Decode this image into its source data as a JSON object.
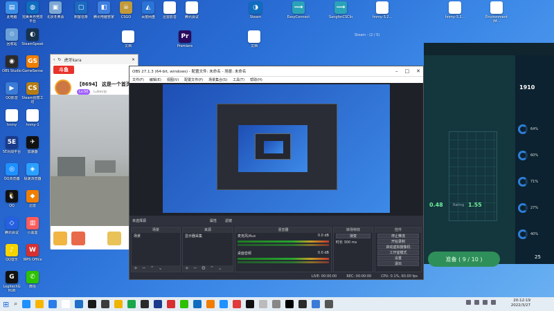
{
  "desktop_icons_col1": [
    {
      "label": "此电脑",
      "color": "#3a8ee6",
      "glyph": "▤"
    },
    {
      "label": "回收站",
      "color": "#6aa0d8",
      "glyph": "♲"
    },
    {
      "label": "OBS Studio",
      "color": "#2b2b2b",
      "glyph": "◉"
    },
    {
      "label": "QQ影音",
      "color": "#3a7bd5",
      "glyph": "▶"
    },
    {
      "label": "hnmy",
      "color": "#ffffff",
      "glyph": ""
    },
    {
      "label": "5E对战平台",
      "color": "#1a3a8a",
      "glyph": "5E"
    },
    {
      "label": "QQ浏览器",
      "color": "#1e90ff",
      "glyph": "◎"
    },
    {
      "label": "QQ",
      "color": "#111111",
      "glyph": "🐧"
    },
    {
      "label": "腾讯会议",
      "color": "#2460e0",
      "glyph": "◇"
    },
    {
      "label": "QQ音乐",
      "color": "#f6d400",
      "glyph": "♪"
    },
    {
      "label": "LogitechG HUB",
      "color": "#111111",
      "glyph": "G"
    }
  ],
  "desktop_icons_col2": [
    {
      "label": "完美世界竞技平台",
      "color": "#0f6dbf",
      "glyph": "◍"
    },
    {
      "label": "SteamSpeak",
      "color": "#16324f",
      "glyph": "◐"
    },
    {
      "label": "GameSense",
      "color": "#f07e00",
      "glyph": "GS"
    },
    {
      "label": "Steam创意工坊",
      "color": "#b57c14",
      "glyph": "CS"
    },
    {
      "label": "hnmy-1",
      "color": "#ffffff",
      "glyph": ""
    },
    {
      "label": "加速器",
      "color": "#111111",
      "glyph": "✈"
    },
    {
      "label": "极速浏览器",
      "color": "#2ba0ff",
      "glyph": "◈"
    },
    {
      "label": "迅雷",
      "color": "#f07e00",
      "glyph": "◆"
    },
    {
      "label": "小黑盒",
      "color": "#ff5c5c",
      "glyph": "▥"
    },
    {
      "label": "WPS Office",
      "color": "#d63031",
      "glyph": "W"
    },
    {
      "label": "微信",
      "color": "#2dc100",
      "glyph": "✆"
    }
  ],
  "desktop_icons_top": [
    {
      "label": "北京冬奥会",
      "color": "#7da8d4",
      "glyph": "▣"
    },
    {
      "label": "刺客信条",
      "color": "#1a6abf",
      "glyph": "▢"
    },
    {
      "label": "腾讯电脑管家",
      "color": "#3f7fe0",
      "glyph": "◧"
    },
    {
      "label": "CSGO",
      "color": "#c29a3b",
      "glyph": "☠"
    },
    {
      "label": "百度网盘",
      "color": "#2a74d6",
      "glyph": "◭"
    },
    {
      "label": "迅雷影音",
      "color": "#ffffff",
      "glyph": ""
    },
    {
      "label": "腾讯会议",
      "color": "#ffffff",
      "glyph": ""
    },
    {
      "label": "Steam",
      "color": "#0f6dbf",
      "glyph": "◑"
    },
    {
      "label": "EasyConnect",
      "color": "#2aa3b8",
      "glyph": "⟶"
    },
    {
      "label": "SangforCSClient",
      "color": "#2aa3b8",
      "glyph": "⟶"
    },
    {
      "label": "hnmy-3.2...",
      "color": "#ffffff",
      "glyph": ""
    },
    {
      "label": "hnmy-3.2...",
      "color": "#ffffff",
      "glyph": ""
    },
    {
      "label": "Environment (M...",
      "color": "#ffffff",
      "glyph": ""
    }
  ],
  "live": {
    "title": "虎牙kara",
    "logo": "斗鱼",
    "room_name": "【8694】 这是一个首页帐",
    "tag": "Lv.50",
    "tag2": "Lukevip"
  },
  "obs": {
    "title": "OBS 27.1.3 (64-bit, windows) - 配置文件: 未命名 - 场景: 未命名",
    "menu": [
      "文件(F)",
      "编辑(E)",
      "视图(V)",
      "配置文件(P)",
      "场景集合(S)",
      "工具(T)",
      "帮助(H)"
    ],
    "toolbar": [
      "未选择源",
      "属性",
      "滤镜"
    ],
    "docks": {
      "scenes": {
        "title": "场景",
        "item": "场景"
      },
      "sources": {
        "title": "来源",
        "item": "显示器采集"
      },
      "mixer": {
        "title": "混音器",
        "ch1": "桌面音频",
        "ch2": "麦克风/Aux",
        "db1": "0.0 dB",
        "db2": "0.0 dB"
      },
      "transitions": {
        "title": "转场特效",
        "type": "渐变",
        "duration_label": "时长",
        "duration": "300 ms"
      },
      "controls": {
        "title": "控件",
        "buttons": [
          "停止推流",
          "开始录制",
          "启动虚拟摄像机",
          "工作室模式",
          "设置",
          "退出"
        ]
      }
    },
    "status": {
      "live": "LIVE: 00:00:00",
      "rec": "REC: 00:00:00",
      "cpu": "CPU: 0.1%, 60.00 fps"
    }
  },
  "game": {
    "title": "Steam - (2 / 5)",
    "elo": "1910",
    "ready": "准备 ( 9 / 10 )",
    "score_left": "0.48",
    "score_right": "1.55",
    "rating_label": "Rating",
    "percents": [
      "64%",
      "60%",
      "71%",
      "27%",
      "40%"
    ],
    "side_label": "25"
  },
  "taskbar": {
    "time": "20:12:19",
    "date": "2022/3/27",
    "icons": [
      "#1e90ff",
      "#f7b500",
      "#2b7de9",
      "#ffffff",
      "#1e70c8",
      "#1a1a1a",
      "#3c3c3c",
      "#f0b400",
      "#19a74a",
      "#2b2b2b",
      "#1a3a8a",
      "#d63031",
      "#2dc100",
      "#0f6dbf",
      "#f07e00",
      "#1e90ff",
      "#e03a3a",
      "#111111",
      "#bbbbbb",
      "#888888",
      "#000000",
      "#2b2b2b",
      "#3a7bd5",
      "#555555"
    ]
  }
}
